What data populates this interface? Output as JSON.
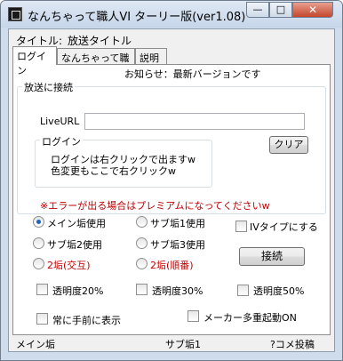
{
  "window": {
    "title": "なんちゃって職人VI ターリー版(ver1.08)",
    "min_glyph": "—",
    "max_glyph": "□",
    "close_glyph": "✕"
  },
  "header": {
    "title_label": "タイトル:",
    "title_value": "放送タイトル"
  },
  "tabs": [
    {
      "label": "ログイン"
    },
    {
      "label": "なんちゃって職人"
    },
    {
      "label": "説明"
    }
  ],
  "login_tab": {
    "notice": "お知らせ：最新バージョンです",
    "connect_group": {
      "label": "放送に接続",
      "liveurl_label": "LiveURL",
      "liveurl_value": "",
      "login_group": {
        "label": "ログイン",
        "line1": "ログインは右クリックで出ますw",
        "line2": "色変更もここで右クリックw"
      },
      "clear_button": "クリア"
    },
    "warning": "※エラーが出る場合はプレミアムになってくださいw",
    "radios": [
      {
        "label": "メイン垢使用",
        "checked": true,
        "red": false
      },
      {
        "label": "サブ垢1使用",
        "checked": false,
        "red": false
      },
      {
        "label": "サブ垢2使用",
        "checked": false,
        "red": false
      },
      {
        "label": "サブ垢3使用",
        "checked": false,
        "red": false
      },
      {
        "label": "2垢(交互)",
        "checked": false,
        "red": true
      },
      {
        "label": "2垢(順番)",
        "checked": false,
        "red": true
      }
    ],
    "iv_type_label": "IVタイプにする",
    "connect_button": "接続",
    "opacity": [
      {
        "label": "透明度20%"
      },
      {
        "label": "透明度30%"
      },
      {
        "label": "透明度50%"
      }
    ],
    "always_on_top": "常に手前に表示",
    "multi_launch": "メーカー多重起動ON"
  },
  "statusbar": {
    "main": "メイン垢",
    "sub": "サブ垢1",
    "comment": "?コメ投稿"
  }
}
